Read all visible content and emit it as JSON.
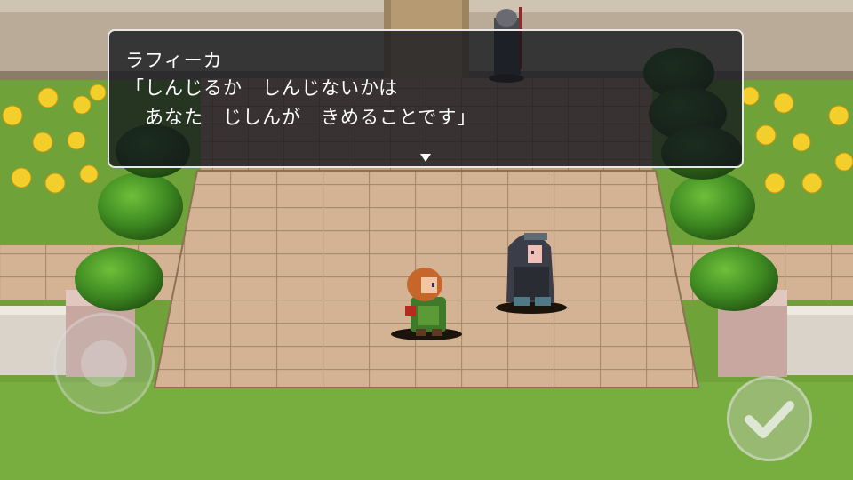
{
  "dialog": {
    "speaker": "ラフィーカ",
    "lines": [
      "「しんじるか　しんじないかは",
      "　あなた　じしんが　きめることです」"
    ]
  },
  "icons": {
    "continue": "triangle-down",
    "confirm": "checkmark",
    "dpad": "virtual-joystick"
  },
  "colors": {
    "grass": "#6fa33a",
    "path": "#cfae8e",
    "dialog_bg": "#12141c",
    "dialog_border": "#e8e8e8"
  }
}
